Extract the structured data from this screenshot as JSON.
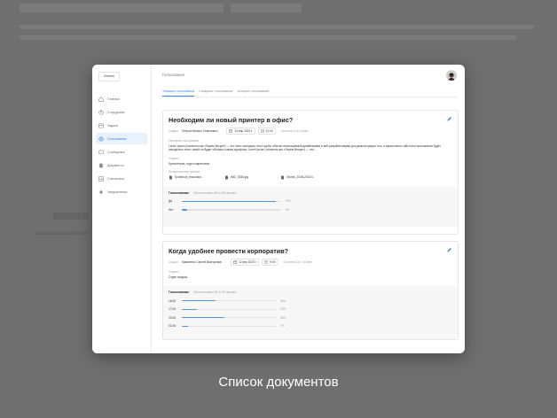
{
  "caption": "Список документов",
  "app": {
    "logo": "Логотип",
    "page_title": "Голосования"
  },
  "sidebar": {
    "items": [
      {
        "label": "Главная",
        "icon": "home-icon"
      },
      {
        "label": "Сотрудники",
        "icon": "users-icon"
      },
      {
        "label": "Задачи",
        "icon": "tasks-icon"
      },
      {
        "label": "Голосования",
        "icon": "vote-icon",
        "active": true
      },
      {
        "label": "Сообщения",
        "icon": "message-icon"
      },
      {
        "label": "Документы",
        "icon": "document-icon"
      },
      {
        "label": "Статистика",
        "icon": "stats-icon"
      },
      {
        "label": "Уведомления",
        "icon": "bell-icon"
      }
    ]
  },
  "tabs": [
    {
      "label": "Текущие голосования",
      "active": true
    },
    {
      "label": "Создание голосования"
    },
    {
      "label": "История голосований"
    }
  ],
  "polls": [
    {
      "title": "Необходим ли новый принтер в офис?",
      "author_label": "Создал",
      "author": "Петров Михаил Семенович",
      "date": "24 апр 2023 г.",
      "time": "12:00",
      "remaining": "Осталось 2 д 24 мин",
      "description_label": "Описание голосования",
      "description": "Lorem Ipsum (читается как «Лорем Ипсум») — это текст-заглушка, текст-рыба, обычно используемый дизайнерами и веб-разработчиками для демонстрации того, в каком месте сайта или приложения будет находиться текст, какой он будет объема и каким шрифтом. Lorem Ipsum (читается как «Лорем Ипсум») — это...",
      "departments_label": "Отделы",
      "departments": "Бухгалтерия, отдел маркетинга",
      "files_label": "Прикрепленные файлы",
      "files": [
        "Sondirova_resolution...",
        "IMG_3036.jpg",
        "Otchet_23.06.2023.ll..."
      ],
      "voting_label": "Голосование",
      "voting_status": "Проголосовало 80 из 85 человек",
      "options": [
        {
          "label": "Да",
          "pct_text": "95%",
          "pct": 95
        },
        {
          "label": "Нет",
          "pct_text": "5%",
          "pct": 5
        }
      ]
    },
    {
      "title": "Когда удобнее провести корпоратив?",
      "author_label": "Создал",
      "author": "Коваленко Сергей Викторович",
      "date": "12 апр 2023 г.",
      "time": "9:00",
      "remaining": "Осталось 15 ч 10 мин",
      "departments_label": "Отделы",
      "departments": "Отдел продаж",
      "voting_label": "Голосование",
      "voting_status": "Проголосовало 90 из 90 человек",
      "options": [
        {
          "label": "16.06",
          "pct_text": "36%",
          "pct": 36
        },
        {
          "label": "17.06",
          "pct_text": "16%",
          "pct": 16
        },
        {
          "label": "23.06",
          "pct_text": "45%",
          "pct": 45
        },
        {
          "label": "01.06",
          "pct_text": "7%",
          "pct": 7
        }
      ]
    }
  ],
  "colors": {
    "accent": "#3b86e0",
    "bar": "#4f95e0",
    "backdrop": "#6f6f6f"
  }
}
